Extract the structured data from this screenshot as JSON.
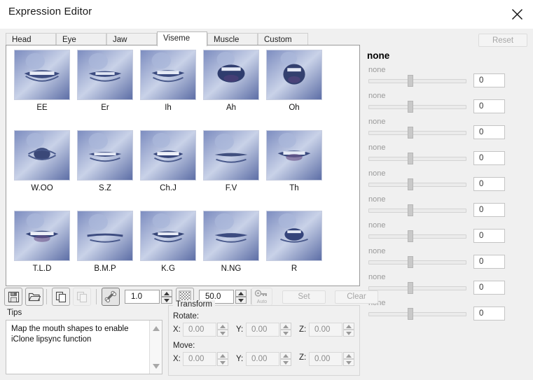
{
  "window": {
    "title": "Expression Editor",
    "close_icon": "close-icon"
  },
  "tabs": [
    {
      "label": "Head",
      "active": false
    },
    {
      "label": "Eye",
      "active": false
    },
    {
      "label": "Jaw",
      "active": false
    },
    {
      "label": "Viseme",
      "active": true
    },
    {
      "label": "Muscle",
      "active": false
    },
    {
      "label": "Custom",
      "active": false
    }
  ],
  "reset_button": {
    "label": "Reset",
    "enabled": false
  },
  "viseme_grid": {
    "rows": [
      [
        "EE",
        "Er",
        "Ih",
        "Ah",
        "Oh"
      ],
      [
        "W.OO",
        "S.Z",
        "Ch.J",
        "F.V",
        "Th"
      ],
      [
        "T.L.D",
        "B.M.P",
        "K.G",
        "N.NG",
        "R"
      ]
    ]
  },
  "slider_panel": {
    "title": "none",
    "sliders": [
      {
        "label": "none",
        "value": "0",
        "position": 50
      },
      {
        "label": "none",
        "value": "0",
        "position": 50
      },
      {
        "label": "none",
        "value": "0",
        "position": 50
      },
      {
        "label": "none",
        "value": "0",
        "position": 50
      },
      {
        "label": "none",
        "value": "0",
        "position": 50
      },
      {
        "label": "none",
        "value": "0",
        "position": 50
      },
      {
        "label": "none",
        "value": "0",
        "position": 50
      },
      {
        "label": "none",
        "value": "0",
        "position": 50
      },
      {
        "label": "none",
        "value": "0",
        "position": 50
      },
      {
        "label": "none",
        "value": "0",
        "position": 50
      }
    ]
  },
  "toolbar": {
    "save_icon": "floppy-disk-icon",
    "open_icon": "folder-open-icon",
    "copy_icon": "copy-icon",
    "paste_icon": "paste-icon",
    "bone_icon": "bone-icon",
    "grid_icon": "checker-grid-icon",
    "autokey_icon": "key-auto-icon",
    "autokey_label": "Auto",
    "strength_value": "1.0",
    "range_value": "50.0",
    "set_label": "Set",
    "clear_label": "Clear"
  },
  "tips": {
    "title": "Tips",
    "text": "Map the mouth shapes to enable iClone lipsync function"
  },
  "transform": {
    "legend": "Transform",
    "rotate_label": "Rotate:",
    "move_label": "Move:",
    "axis_x": "X:",
    "axis_y": "Y:",
    "axis_z": "Z:",
    "rotate": {
      "x": "0.00",
      "y": "0.00",
      "z": "0.00"
    },
    "move": {
      "x": "0.00",
      "y": "0.00",
      "z": "0.00"
    }
  },
  "colors": {
    "window_bg": "#f0f0f0",
    "panel_bg": "#ffffff",
    "thumb_blue": "#5a6ea8",
    "text": "#1a1a1a",
    "muted_text": "#9a9a9a"
  }
}
